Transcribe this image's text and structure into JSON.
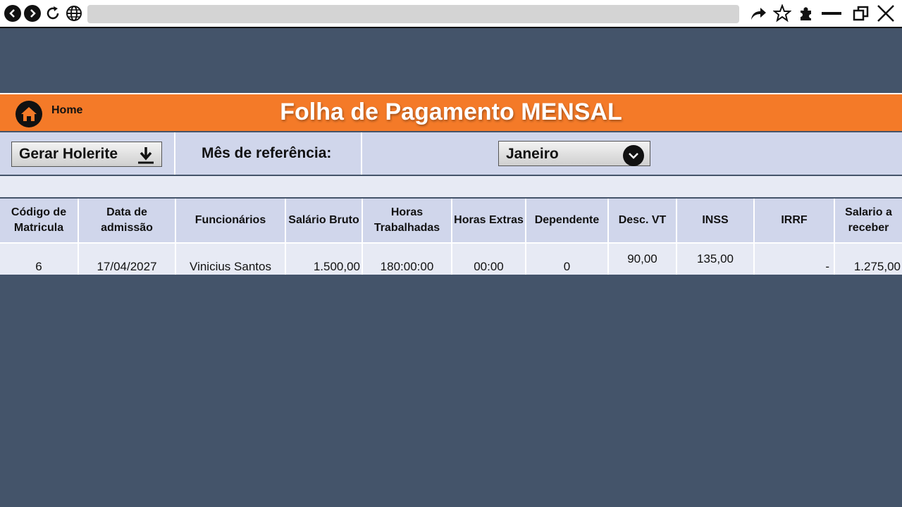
{
  "browser": {
    "icons": [
      "back-icon",
      "forward-icon",
      "reload-icon",
      "globe-icon",
      "share-icon",
      "star-icon",
      "extensions-icon",
      "minimize-icon",
      "restore-icon",
      "close-icon"
    ]
  },
  "header": {
    "home_label": "Home",
    "title": "Folha de Pagamento MENSAL",
    "accent": "#F47A28"
  },
  "controls": {
    "gerar_label": "Gerar Holerite",
    "mes_label": "Mês de referência:",
    "month_selected": "Janeiro"
  },
  "table": {
    "headers": {
      "codigo": "Código de Matricula",
      "admissao": "Data de admissão",
      "funcionarios": "Funcionários",
      "salario_bruto": "Salário Bruto",
      "horas_trabalhadas": "Horas Trabalhadas",
      "horas_extras": "Horas Extras",
      "dependente": "Dependente",
      "desc_vt": "Desc. VT",
      "inss": "INSS",
      "irrf": "IRRF",
      "salario_receber": "Salario a receber"
    },
    "rows": [
      {
        "codigo": "6",
        "admissao": "17/04/2027",
        "funcionarios": "Vinicius Santos",
        "salario_bruto": "1.500,00",
        "horas_trabalhadas": "180:00:00",
        "horas_extras": "00:00",
        "dependente": "0",
        "desc_vt": "90,00",
        "inss": "135,00",
        "irrf": "-",
        "salario_receber": "1.275,00"
      }
    ]
  }
}
